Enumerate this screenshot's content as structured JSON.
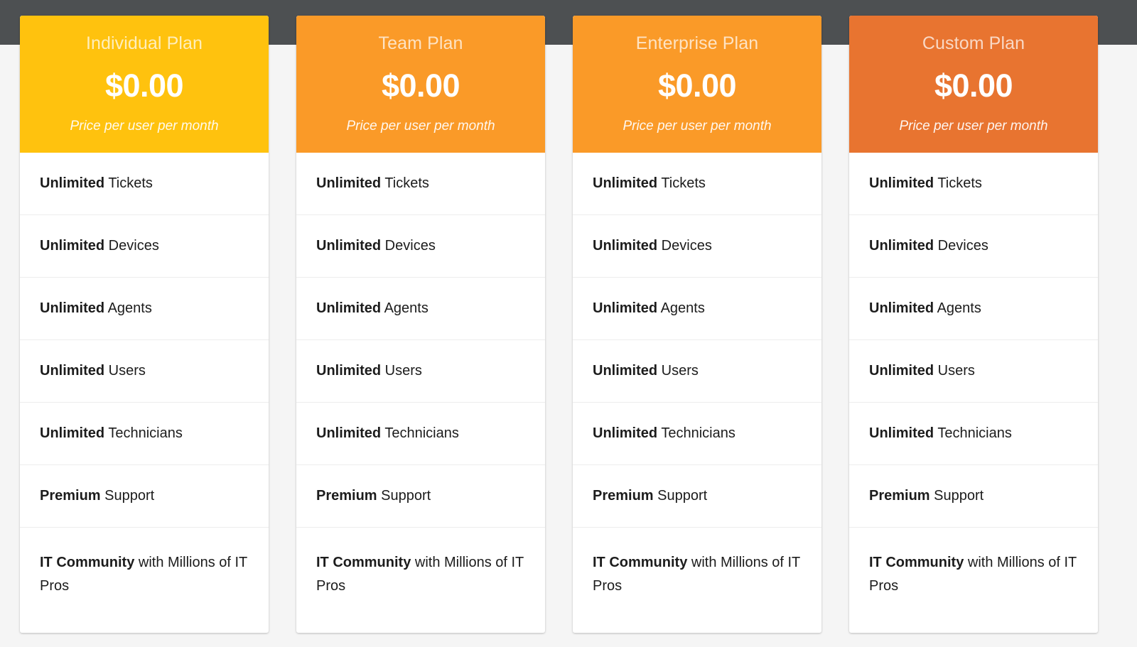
{
  "page": {
    "topbar_color": "#4d5052",
    "background_color": "#f5f5f5"
  },
  "plans": [
    {
      "title": "Individual Plan",
      "price": "$0.00",
      "note": "Price per user per month",
      "header_color": "#ffc20e",
      "features": [
        {
          "emphasis": "Unlimited",
          "rest": " Tickets"
        },
        {
          "emphasis": "Unlimited",
          "rest": " Devices"
        },
        {
          "emphasis": "Unlimited",
          "rest": " Agents"
        },
        {
          "emphasis": "Unlimited",
          "rest": " Users"
        },
        {
          "emphasis": "Unlimited",
          "rest": " Technicians"
        },
        {
          "emphasis": "Premium",
          "rest": " Support"
        },
        {
          "emphasis": "IT Community",
          "rest": " with Millions of IT Pros"
        }
      ]
    },
    {
      "title": "Team Plan",
      "price": "$0.00",
      "note": "Price per user per month",
      "header_color": "#fa9a28",
      "features": [
        {
          "emphasis": "Unlimited",
          "rest": " Tickets"
        },
        {
          "emphasis": "Unlimited",
          "rest": " Devices"
        },
        {
          "emphasis": "Unlimited",
          "rest": " Agents"
        },
        {
          "emphasis": "Unlimited",
          "rest": " Users"
        },
        {
          "emphasis": "Unlimited",
          "rest": " Technicians"
        },
        {
          "emphasis": "Premium",
          "rest": " Support"
        },
        {
          "emphasis": "IT Community",
          "rest": " with Millions of IT Pros"
        }
      ]
    },
    {
      "title": "Enterprise Plan",
      "price": "$0.00",
      "note": "Price per user per month",
      "header_color": "#fa9a28",
      "features": [
        {
          "emphasis": "Unlimited",
          "rest": " Tickets"
        },
        {
          "emphasis": "Unlimited",
          "rest": " Devices"
        },
        {
          "emphasis": "Unlimited",
          "rest": " Agents"
        },
        {
          "emphasis": "Unlimited",
          "rest": " Users"
        },
        {
          "emphasis": "Unlimited",
          "rest": " Technicians"
        },
        {
          "emphasis": "Premium",
          "rest": " Support"
        },
        {
          "emphasis": "IT Community",
          "rest": " with Millions of IT Pros"
        }
      ]
    },
    {
      "title": "Custom Plan",
      "price": "$0.00",
      "note": "Price per user per month",
      "header_color": "#e87430",
      "features": [
        {
          "emphasis": "Unlimited",
          "rest": " Tickets"
        },
        {
          "emphasis": "Unlimited",
          "rest": " Devices"
        },
        {
          "emphasis": "Unlimited",
          "rest": " Agents"
        },
        {
          "emphasis": "Unlimited",
          "rest": " Users"
        },
        {
          "emphasis": "Unlimited",
          "rest": " Technicians"
        },
        {
          "emphasis": "Premium",
          "rest": " Support"
        },
        {
          "emphasis": "IT Community",
          "rest": " with Millions of IT Pros"
        }
      ]
    }
  ]
}
